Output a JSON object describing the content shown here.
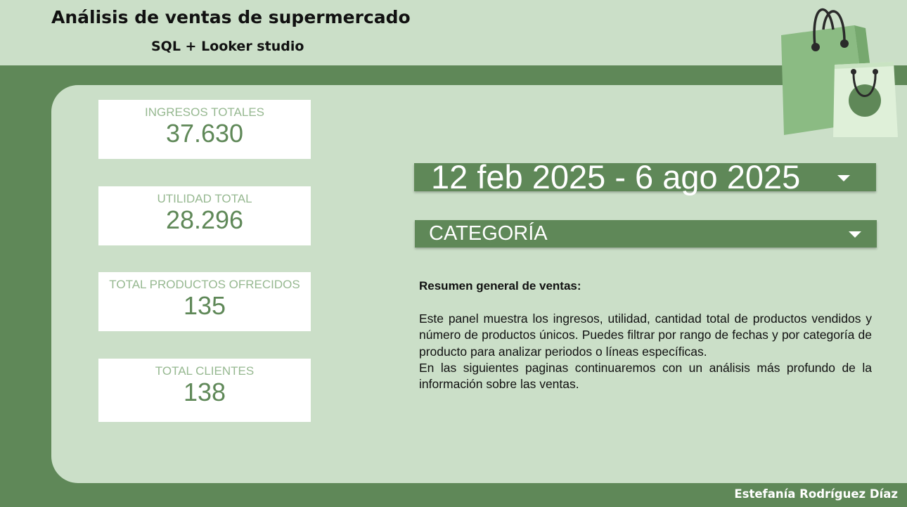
{
  "header": {
    "title": "Análisis de ventas de supermercado",
    "subtitle": "SQL + Looker studio"
  },
  "kpis": [
    {
      "label": "INGRESOS TOTALES",
      "value": "37.630"
    },
    {
      "label": "UTILIDAD TOTAL",
      "value": "28.296"
    },
    {
      "label": "TOTAL PRODUCTOS OFRECIDOS",
      "value": "135"
    },
    {
      "label": "TOTAL CLIENTES",
      "value": "138"
    }
  ],
  "filters": {
    "date_range": "12 feb 2025 - 6 ago 2025",
    "category": "CATEGORÍA"
  },
  "summary": {
    "title": "Resumen general de ventas:",
    "paragraph1": "Este panel muestra los ingresos, utilidad, cantidad total de productos vendidos y número de productos únicos. Puedes filtrar por rango de fechas y por categoría de producto para analizar periodos o líneas específicas.",
    "paragraph2": "En las siguientes paginas continuaremos con un análisis más profundo de la información sobre las ventas."
  },
  "footer": {
    "author": "Estefanía Rodríguez Díaz"
  },
  "icons": {
    "decoration": "shopping-bags-icon",
    "dropdown": "chevron-down-icon"
  },
  "colors": {
    "background": "#cbdfc8",
    "accent_dark_green": "#5f8858",
    "kpi_label": "#96b890",
    "kpi_value": "#5f8858",
    "bag_primary": "#8bbb83",
    "bag_secondary": "#dff0d9"
  }
}
